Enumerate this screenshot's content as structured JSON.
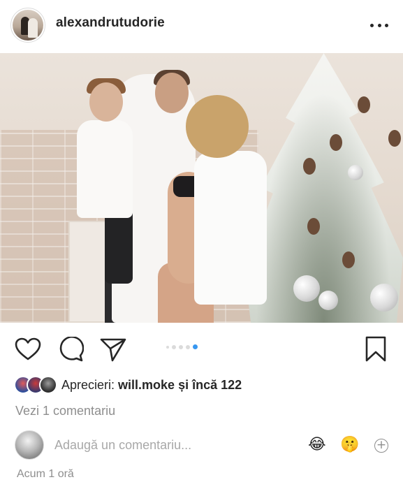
{
  "post": {
    "username": "alexandrutudorie",
    "more_icon": "more-horizontal-icon",
    "photo_alt": "family photo",
    "carousel": {
      "count": 4,
      "active_index": 3
    }
  },
  "actions": {
    "like_icon": "heart-icon",
    "comment_icon": "comment-bubble-icon",
    "share_icon": "paper-plane-icon",
    "save_icon": "bookmark-icon"
  },
  "likes": {
    "prefix": "Aprecieri: ",
    "user": "will.moke",
    "suffix": " și încă 122"
  },
  "comments": {
    "view_all": "Vezi 1 comentariu"
  },
  "add_comment": {
    "placeholder": "Adaugă un comentariu...",
    "emoji_1": "😂",
    "emoji_2": "🤫",
    "add_more": "+"
  },
  "timestamp": "Acum 1 oră",
  "colors": {
    "accent": "#3897f0",
    "muted": "#8e8e8e",
    "text": "#262626"
  }
}
